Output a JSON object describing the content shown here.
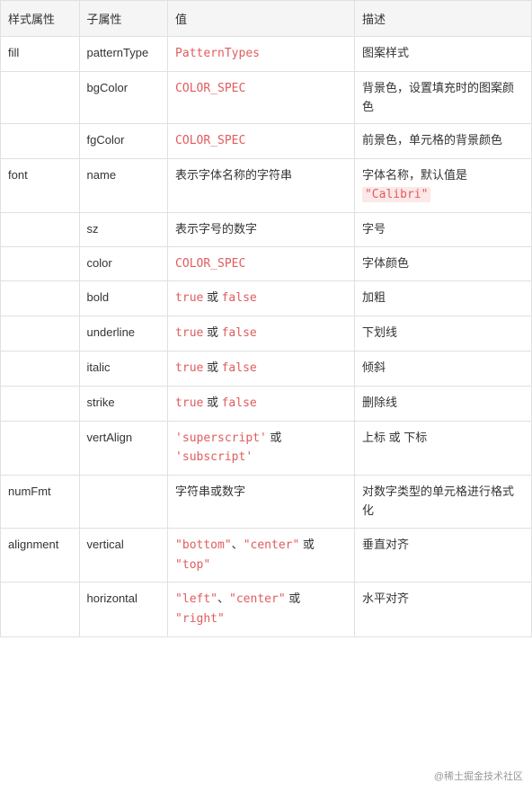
{
  "table": {
    "headers": [
      "样式属性",
      "子属性",
      "值",
      "描述"
    ],
    "rows": [
      {
        "style": "fill",
        "sub": "patternType",
        "val_type": "link",
        "val": "PatternTypes",
        "desc": "图案样式"
      },
      {
        "style": "",
        "sub": "bgColor",
        "val_type": "code",
        "val": "COLOR_SPEC",
        "desc": "背景色，设置填充时的图案颜色"
      },
      {
        "style": "",
        "sub": "fgColor",
        "val_type": "code",
        "val": "COLOR_SPEC",
        "desc": "前景色，单元格的背景颜色"
      },
      {
        "style": "font",
        "sub": "name",
        "val_type": "text",
        "val": "表示字体名称的字符串",
        "desc_html": "字体名称，默认值是 <span class='highlight-box'>\"Calibri\"</span>"
      },
      {
        "style": "",
        "sub": "sz",
        "val_type": "text",
        "val": "表示字号的数字",
        "desc": "字号"
      },
      {
        "style": "",
        "sub": "color",
        "val_type": "code",
        "val": "COLOR_SPEC",
        "desc": "字体颜色"
      },
      {
        "style": "",
        "sub": "bold",
        "val_type": "bool",
        "val": "true 或 false",
        "desc": "加粗"
      },
      {
        "style": "",
        "sub": "underline",
        "val_type": "bool",
        "val": "true 或 false",
        "desc": "下划线"
      },
      {
        "style": "",
        "sub": "italic",
        "val_type": "bool",
        "val": "true 或 false",
        "desc": "倾斜"
      },
      {
        "style": "",
        "sub": "strike",
        "val_type": "bool",
        "val": "true 或 false",
        "desc": "删除线"
      },
      {
        "style": "",
        "sub": "vertAlign",
        "val_type": "enum2",
        "val": "'superscript' 或 'subscript'",
        "desc": "上标 或 下标"
      },
      {
        "style": "numFmt",
        "sub": "",
        "val_type": "text",
        "val": "字符串或数字",
        "desc": "对数字类型的单元格进行格式化"
      },
      {
        "style": "alignment",
        "sub": "vertical",
        "val_type": "enum3",
        "val": "\"bottom\"、\"center\" 或 \"top\"",
        "desc": "垂直对齐"
      },
      {
        "style": "",
        "sub": "horizontal",
        "val_type": "enum3h",
        "val": "\"left\"、\"center\" 或 \"right\"",
        "desc": "水平对齐"
      }
    ]
  },
  "watermark": "@稀土掘金技术社区"
}
